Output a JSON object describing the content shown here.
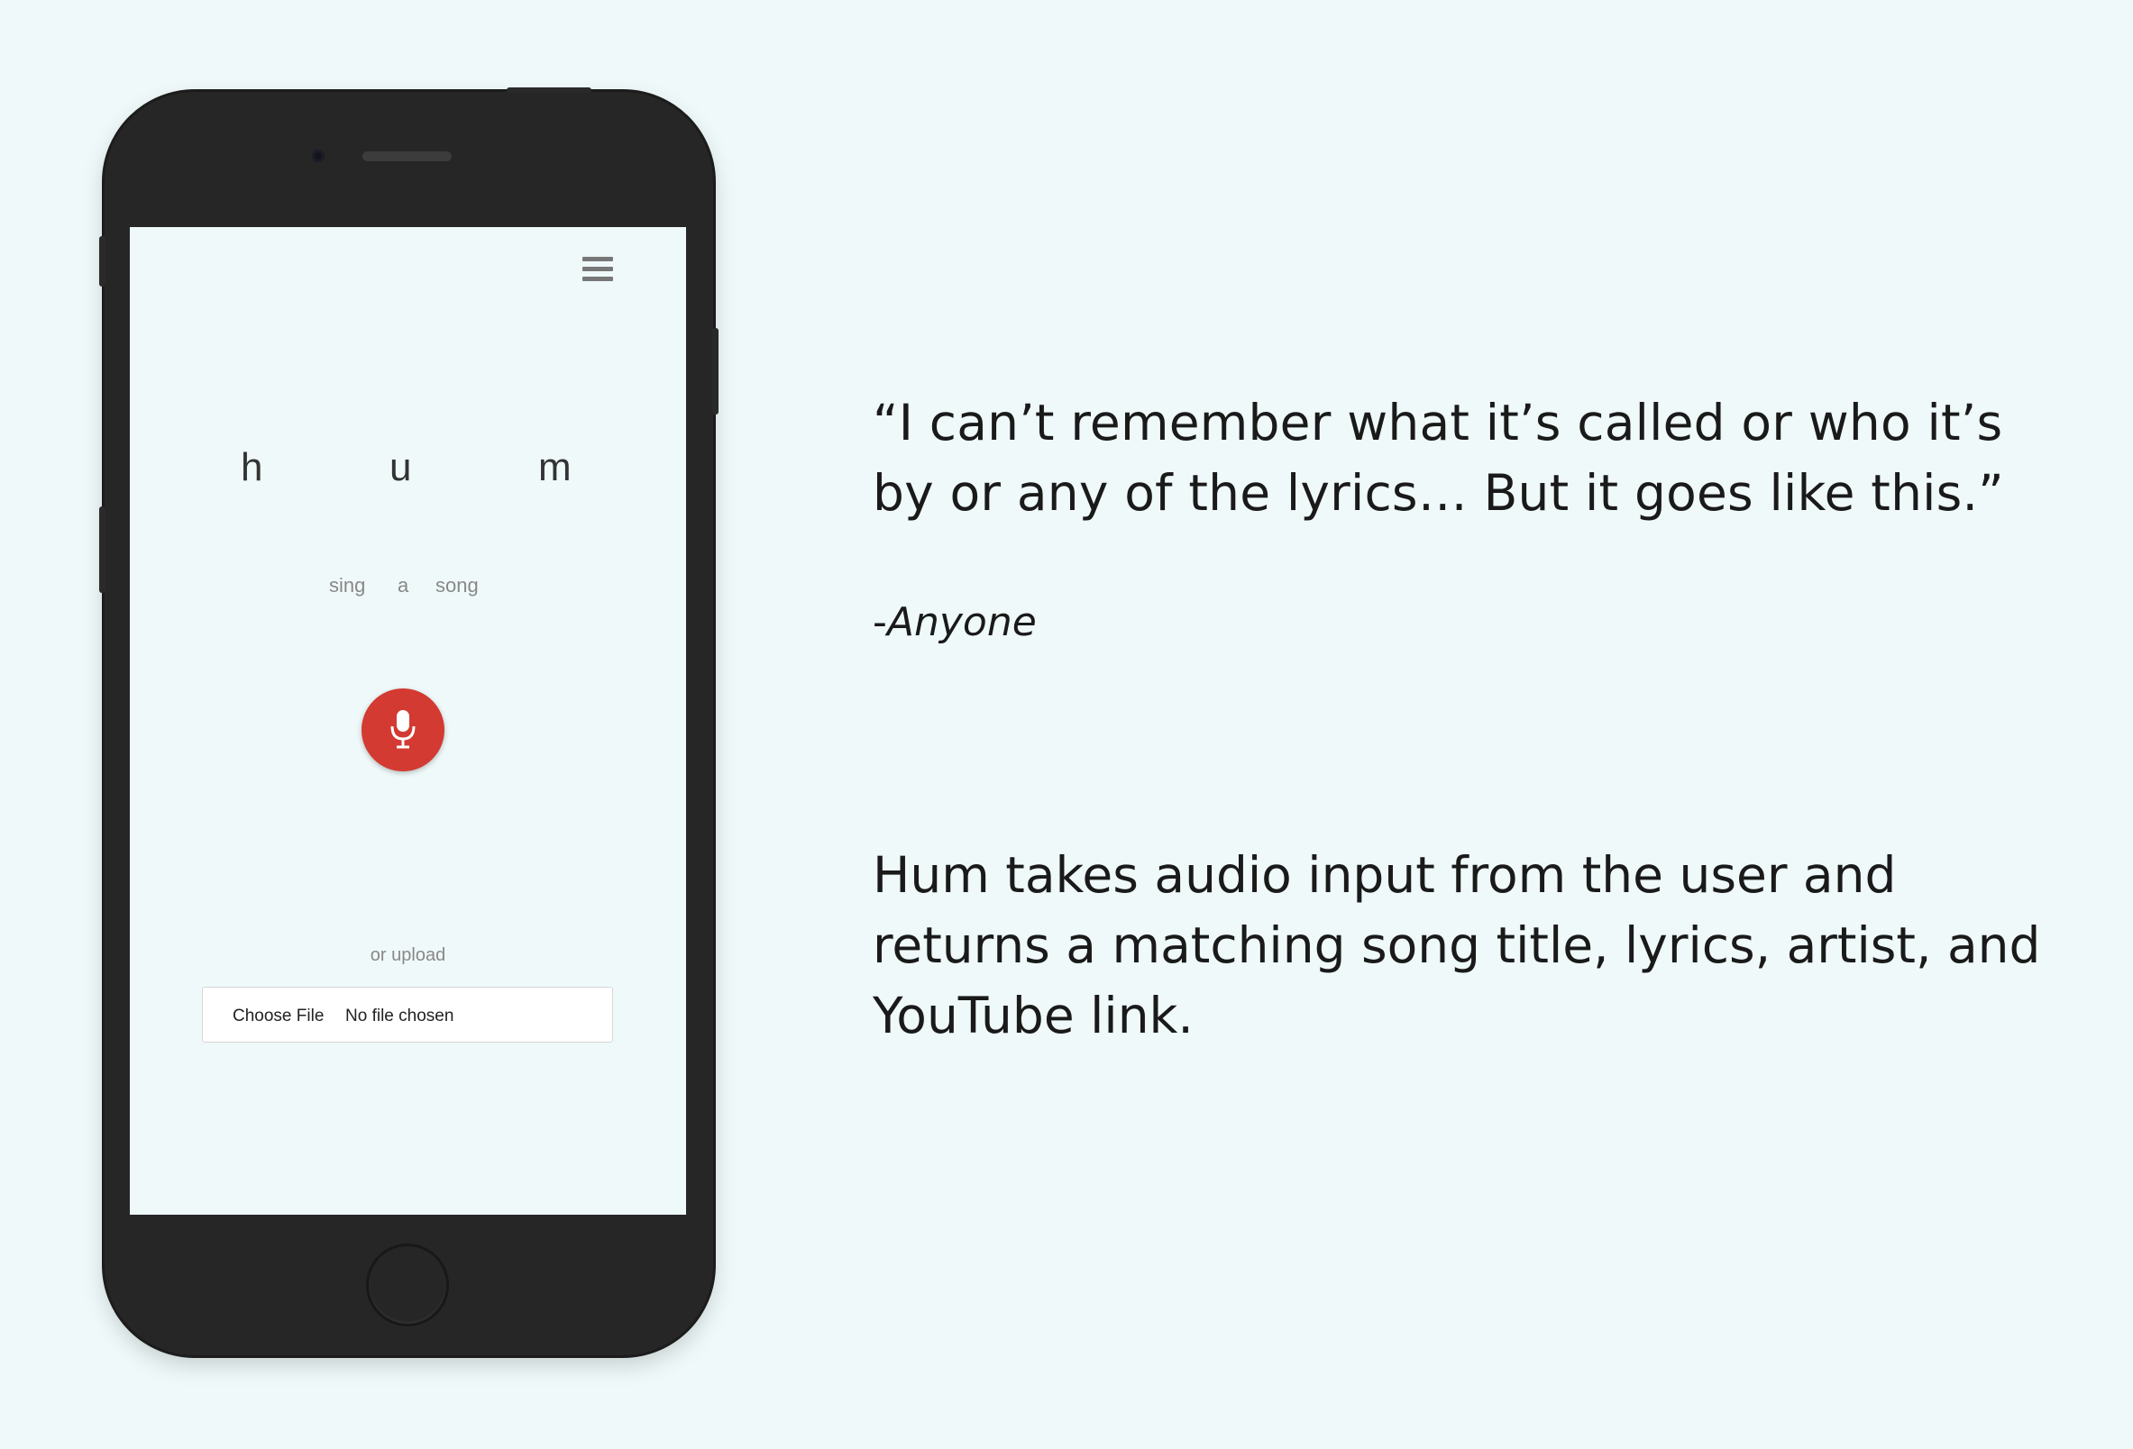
{
  "app": {
    "logo_letters": [
      "h",
      "u",
      "m"
    ],
    "tagline_words": [
      "sing",
      "a",
      "song"
    ],
    "menu_icon": "hamburger-menu-icon",
    "mic_icon": "microphone-icon",
    "accent_color": "#d33a32",
    "upload": {
      "prompt": "or upload",
      "button_label": "Choose File",
      "status": "No file chosen"
    }
  },
  "marketing": {
    "quote": "“I can’t remember what it’s called or who it’s by or any of the lyrics… But it goes like this.”",
    "attribution_prefix": "-",
    "attribution_name": "Anyone",
    "description": "Hum takes audio input from the user and returns a matching song title, lyrics, artist, and YouTube link."
  }
}
